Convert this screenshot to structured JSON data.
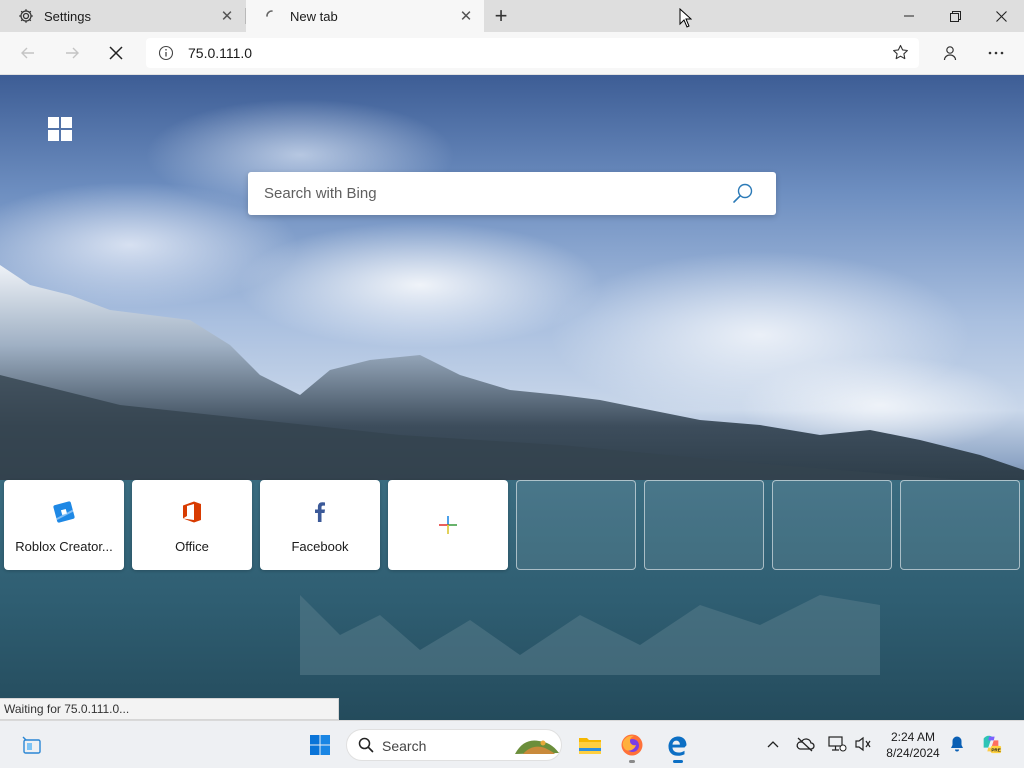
{
  "tabs": [
    {
      "label": "Settings",
      "icon": "gear-icon",
      "active": false
    },
    {
      "label": "New tab",
      "icon": "loading-spinner-icon",
      "active": true
    }
  ],
  "toolbar": {
    "address": "75.0.111.0"
  },
  "page": {
    "search_placeholder": "Search with Bing",
    "quick_links": [
      {
        "label": "Roblox Creator...",
        "icon": "roblox-icon"
      },
      {
        "label": "Office",
        "icon": "office-icon"
      },
      {
        "label": "Facebook",
        "icon": "facebook-icon"
      },
      {
        "label": "",
        "icon": "add-icon"
      }
    ]
  },
  "status_bar": "Waiting for 75.0.111.0...",
  "taskbar": {
    "search_label": "Search",
    "time": "2:24 AM",
    "date": "8/24/2024"
  },
  "colors": {
    "edge_blue": "#0c6fc4",
    "office_red": "#d83b01",
    "facebook_blue": "#3b5998",
    "roblox_blue": "#1e88e5"
  }
}
